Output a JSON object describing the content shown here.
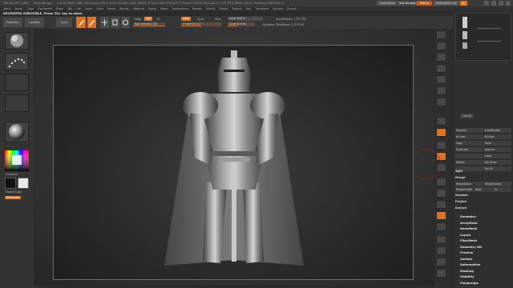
{
  "titlebar": {
    "app": "ZBrush 4R7 (x64)",
    "doc": "ProjectKnight",
    "stats": "▸ Free Mem 3.665 GB ▸ Active Mem 874 ▸ Scratch Disk 2563 ▸ ZTime:1.663 RTime:0.6 Timer:1.694 ▸ PolyCount:1.199 MP ▸ MeshCount:1 Meshes:1185EXEo:1",
    "quicksave": "QuickSave",
    "see_through": "See-through  0",
    "menus": "Menus",
    "default_ui": "DefaultZScript",
    "script": "►"
  },
  "menubar": [
    "Alpha",
    "Brush",
    "Color",
    "Document",
    "Draw",
    "Edit",
    "File",
    "Layer",
    "Light",
    "Macro",
    "Marker",
    "Material",
    "Movie",
    "Picker",
    "Preferences",
    "Render",
    "Stencil",
    "Stroke",
    "Texture",
    "Tool",
    "Transform",
    "Zplugin",
    "Zscript"
  ],
  "notice": "DECIMATED SUBVISIBLE. Press 'Esc' key to abort.",
  "toolbar": {
    "projection_master": "Projection Master",
    "lightbox": "LightBox",
    "quick_sketch": "Quick Sketch",
    "edit": "Edit",
    "draw": "Draw",
    "move": "Move",
    "scale": "Scale",
    "rotate": "Rotate",
    "mrgb": "Mrgb",
    "rgb": "Rgb",
    "m": "M",
    "zadd": "Zadd",
    "zsub": "Zsub",
    "zcut": "Zcut",
    "rgb_intensity": "Rgb Intensity 100",
    "z_intensity": "Z Intensity 51",
    "focal_shift": "Focal Shift 0",
    "draw_size": "Draw Size 62",
    "dynamic": "Dynamic",
    "active_points": "ActivePoints: 1,717 Mil",
    "total_points": "TotalPoints: 5,574 Mil"
  },
  "leftshelf": {
    "gradient_label": "Gradient",
    "switch_color": "SwitchColor",
    "alternate": "Alternate"
  },
  "tray": {
    "list_all": "List All",
    "subtool_buttons": [
      [
        "Rename",
        "AutoReorder"
      ],
      [
        "All Low",
        "All High"
      ],
      [
        "Copy",
        "Paste"
      ],
      [
        "Duplicate",
        "Append"
      ],
      [
        "",
        "Insert"
      ],
      [
        "Delete",
        "Del Other"
      ],
      [
        "",
        "Del All"
      ]
    ],
    "split": "Split",
    "merge": "Merge",
    "merge_down": "MergeDown",
    "merge_similar": "MergeSimilar",
    "merge_visible": "MergeVisible",
    "weld": "Weld",
    "uv": "Uv",
    "remesh": "Remesh",
    "project": "Project",
    "extract": "Extract",
    "sections": [
      "Geometry",
      "ArrayMesh",
      "NanoMesh",
      "Layers",
      "FiberMesh",
      "Geometry HD",
      "Preview",
      "Surface",
      "Deformation",
      "Masking",
      "Visibility",
      "Polygroups"
    ]
  },
  "accent_color": "#e0721e"
}
